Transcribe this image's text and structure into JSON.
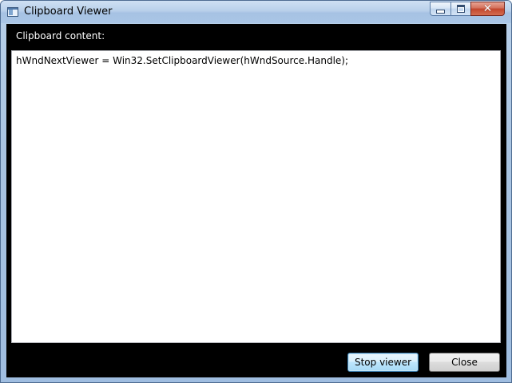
{
  "window": {
    "title": "Clipboard Viewer",
    "icon": "window-app-icon",
    "caption_buttons": {
      "minimize_icon": "minimize-icon",
      "maximize_icon": "maximize-icon",
      "close_glyph": "✕"
    }
  },
  "main": {
    "content_label": "Clipboard content:",
    "clipboard_text": "hWndNextViewer = Win32.SetClipboardViewer(hWndSource.Handle);"
  },
  "footer": {
    "stop_button_label": "Stop viewer",
    "close_button_label": "Close"
  },
  "colors": {
    "client_background": "#000000",
    "textbox_background": "#ffffff",
    "title_bar": "#b8d0ea",
    "close_button": "#c2452c"
  }
}
